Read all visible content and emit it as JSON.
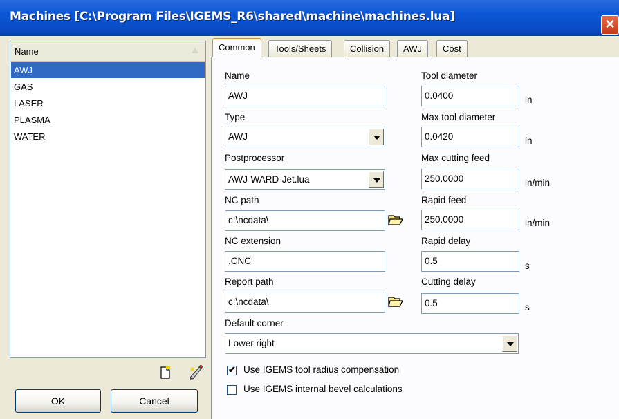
{
  "window": {
    "title": "Machines  [C:\\Program Files\\IGEMS_R6\\shared\\machine\\machines.lua]",
    "close_glyph": "✕"
  },
  "machine_list": {
    "column_header": "Name",
    "items": [
      "AWJ",
      "GAS",
      "LASER",
      "PLASMA",
      "WATER"
    ],
    "selected": "AWJ"
  },
  "list_toolbar": {
    "icons": [
      "new-document-icon",
      "edit-icon"
    ]
  },
  "buttons": {
    "ok": "OK",
    "cancel": "Cancel"
  },
  "tabs": [
    "Common",
    "Tools/Sheets",
    "Collision",
    "AWJ",
    "Cost"
  ],
  "active_tab": "Common",
  "common": {
    "name": {
      "label": "Name",
      "value": "AWJ"
    },
    "type": {
      "label": "Type",
      "value": "AWJ"
    },
    "postprocessor": {
      "label": "Postprocessor",
      "value": "AWJ-WARD-Jet.lua"
    },
    "nc_path": {
      "label": "NC path",
      "value": "c:\\ncdata\\"
    },
    "nc_extension": {
      "label": "NC extension",
      "value": ".CNC"
    },
    "report_path": {
      "label": "Report path",
      "value": "c:\\ncdata\\"
    },
    "default_corner": {
      "label": "Default corner",
      "value": "Lower right"
    },
    "tool_diameter": {
      "label": "Tool diameter",
      "value": "0.0400",
      "unit": "in"
    },
    "max_tool_diameter": {
      "label": "Max tool diameter",
      "value": "0.0420",
      "unit": "in"
    },
    "max_cutting_feed": {
      "label": "Max cutting feed",
      "value": "250.0000",
      "unit": "in/min"
    },
    "rapid_feed": {
      "label": "Rapid feed",
      "value": "250.0000",
      "unit": "in/min"
    },
    "rapid_delay": {
      "label": "Rapid delay",
      "value": "0.5",
      "unit": "s"
    },
    "cutting_delay": {
      "label": "Cutting delay",
      "value": "0.5",
      "unit": "s"
    },
    "use_tool_radius_comp": {
      "label": "Use IGEMS tool radius compensation",
      "checked": true,
      "mark": "✔"
    },
    "use_internal_bevel": {
      "label": "Use IGEMS internal bevel calculations",
      "checked": false
    }
  }
}
